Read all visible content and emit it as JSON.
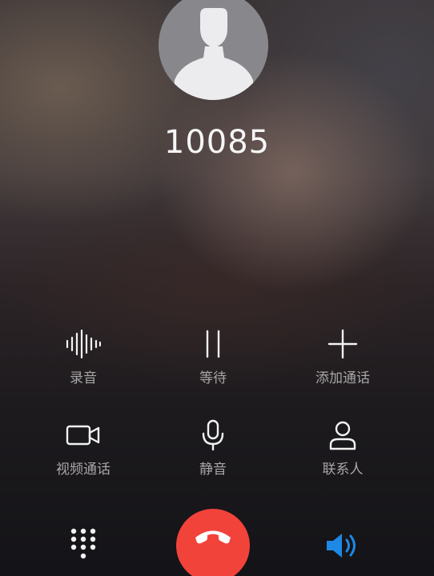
{
  "call": {
    "number": "10085"
  },
  "actions": [
    {
      "label": "录音",
      "icon": "waveform-icon"
    },
    {
      "label": "等待",
      "icon": "pause-icon"
    },
    {
      "label": "添加通话",
      "icon": "plus-icon"
    },
    {
      "label": "视频通话",
      "icon": "video-camera-icon"
    },
    {
      "label": "静音",
      "icon": "microphone-icon"
    },
    {
      "label": "联系人",
      "icon": "person-icon"
    }
  ],
  "bottom": {
    "dialpad_icon": "dialpad-icon",
    "hangup_icon": "phone-hangup-icon",
    "speaker_icon": "speaker-icon"
  },
  "colors": {
    "hangup": "#f2433b",
    "speaker_accent": "#1e88e5",
    "label": "#a9a6a7"
  }
}
